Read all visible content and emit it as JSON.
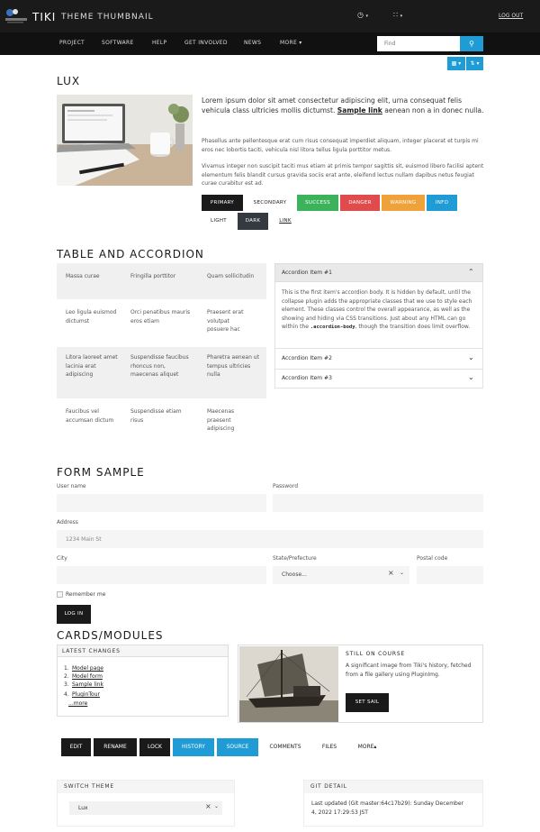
{
  "header": {
    "brand": "TIKI",
    "subtitle": "THEME THUMBNAIL",
    "clock_icon": "clock-icon",
    "grid_icon": "apps-icon",
    "logout": "LOG OUT"
  },
  "nav": {
    "items": [
      "PROJECT",
      "SOFTWARE",
      "HELP",
      "GET INVOLVED",
      "NEWS",
      "MORE"
    ],
    "search_placeholder": "Find",
    "search_icon": "search-icon"
  },
  "lux": {
    "title": "LUX",
    "lead_before": "Lorem ipsum dolor sit amet consectetur adipiscing elit, urna consequat felis vehicula class ultricies mollis dictumst.",
    "lead_link": "Sample link",
    "lead_after": "aenean non a in donec nulla.",
    "p2": "Phasellus ante pellentesque erat cum risus consequat imperdiet aliquam, integer placerat et turpis mi eros nec lobortis taciti, vehicula nisl litora tellus ligula porttitor metus.",
    "p3": "Vivamus integer non suscipit taciti mus etiam at primis tempor sagittis sit, euismod libero facilisi aptent elementum felis blandit cursus gravida sociis erat ante, eleifend lectus nullam dapibus netus feugiat curae curabitur est ad.",
    "buttons": [
      "PRIMARY",
      "SECONDARY",
      "SUCCESS",
      "DANGER",
      "WARNING",
      "INFO",
      "LIGHT",
      "DARK",
      "LINK"
    ]
  },
  "table": {
    "title": "TABLE AND ACCORDION",
    "rows": [
      [
        "Massa curae",
        "Fringilla porttitor",
        "Quam sollicitudin"
      ],
      [
        "Leo ligula euismod dictumst",
        "Orci penatibus mauris eros etiam",
        "Praesent erat volutpat posuere hac"
      ],
      [
        "Litora laoreet amet lacinia erat adipiscing",
        "Suspendisse faucibus rhoncus non, maecenas aliquet",
        "Pharetra aenean ut tempus ultricies nulla"
      ],
      [
        "Faucibus vel accumsan dictum",
        "Suspendisse etiam risus",
        "Maecenas praesent adipiscing"
      ]
    ]
  },
  "accordion": {
    "item1": "Accordion Item #1",
    "body_before": "This is the first item's accordion body. It is hidden by default, until the collapse plugin adds the appropriate classes that we use to style each element. These classes control the overall appearance, as well as the showing and hiding via CSS transitions. Just about any HTML can go within the",
    "body_code": ".accordion-body",
    "body_after": ", though the transition does limit overflow.",
    "item2": "Accordion Item #2",
    "item3": "Accordion Item #3"
  },
  "form": {
    "title": "FORM SAMPLE",
    "username_label": "User name",
    "password_label": "Password",
    "address_label": "Address",
    "address_placeholder": "1234 Main St",
    "city_label": "City",
    "state_label": "State/Prefecture",
    "state_value": "Choose...",
    "postal_label": "Postal code",
    "remember": "Remember me",
    "login": "LOG IN"
  },
  "cards": {
    "title": "CARDS/MODULES",
    "latest_title": "LATEST CHANGES",
    "latest_items": [
      "Model page",
      "Model form",
      "Sample link",
      "PluginTour"
    ],
    "more": "...more",
    "course_title": "STILL ON COURSE",
    "course_text": "A significant image from Tiki's history, fetched from a file gallery using PluginImg.",
    "set_sail": "SET SAIL"
  },
  "bottom_menu": [
    "EDIT",
    "RENAME",
    "LOCK",
    "HISTORY",
    "SOURCE",
    "COMMENTS",
    "FILES",
    "MORE"
  ],
  "switch_theme": {
    "title": "SWITCH THEME",
    "value": "Lux"
  },
  "git": {
    "title": "GIT DETAIL",
    "text": "Last updated (Git master:64c17b29): Sunday December 4, 2022 17:29:53 JST"
  }
}
